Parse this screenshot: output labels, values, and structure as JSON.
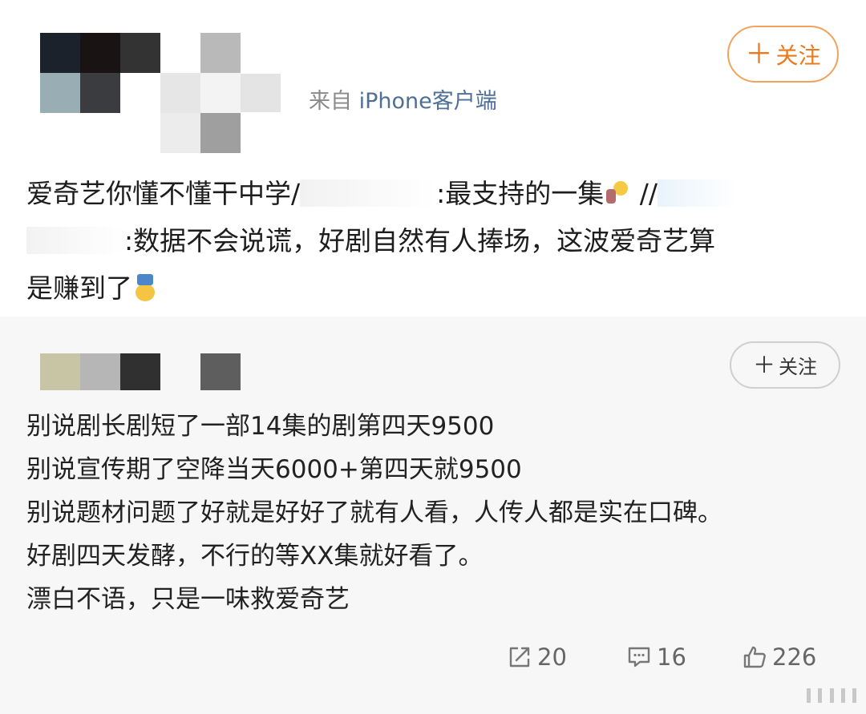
{
  "post": {
    "source_prefix": "来自",
    "source_app": "iPhone客户端",
    "follow_label": "关注",
    "text_lines": [
      [
        "爱奇艺你懂不懂干中学/",
        ":最支持的一集",
        " //"
      ],
      [
        ":数据不会说谎，好剧自然有人捧场，这波爱奇艺算"
      ],
      [
        "是赚到了"
      ]
    ]
  },
  "repost": {
    "follow_label": "关注",
    "lines": [
      "别说剧长剧短了一部14集的剧第四天9500",
      "别说宣传期了空降当天6000+第四天就9500",
      "别说题材问题了好就是好好了就有人看，人传人都是实在口碑。",
      "好剧四天发酵，不行的等XX集就好看了。",
      "漂白不语，只是一味救爱奇艺"
    ],
    "actions": {
      "repost_count": "20",
      "comment_count": "16",
      "like_count": "226"
    }
  },
  "colors": {
    "follow_orange": "#ea7a1d",
    "source_blue": "#4f6f94",
    "repost_bg": "#f7f7f7"
  },
  "icons": [
    "plus-icon",
    "repost-icon",
    "comment-icon",
    "like-icon",
    "emoji-bulb-icon",
    "emoji-face-icon"
  ]
}
